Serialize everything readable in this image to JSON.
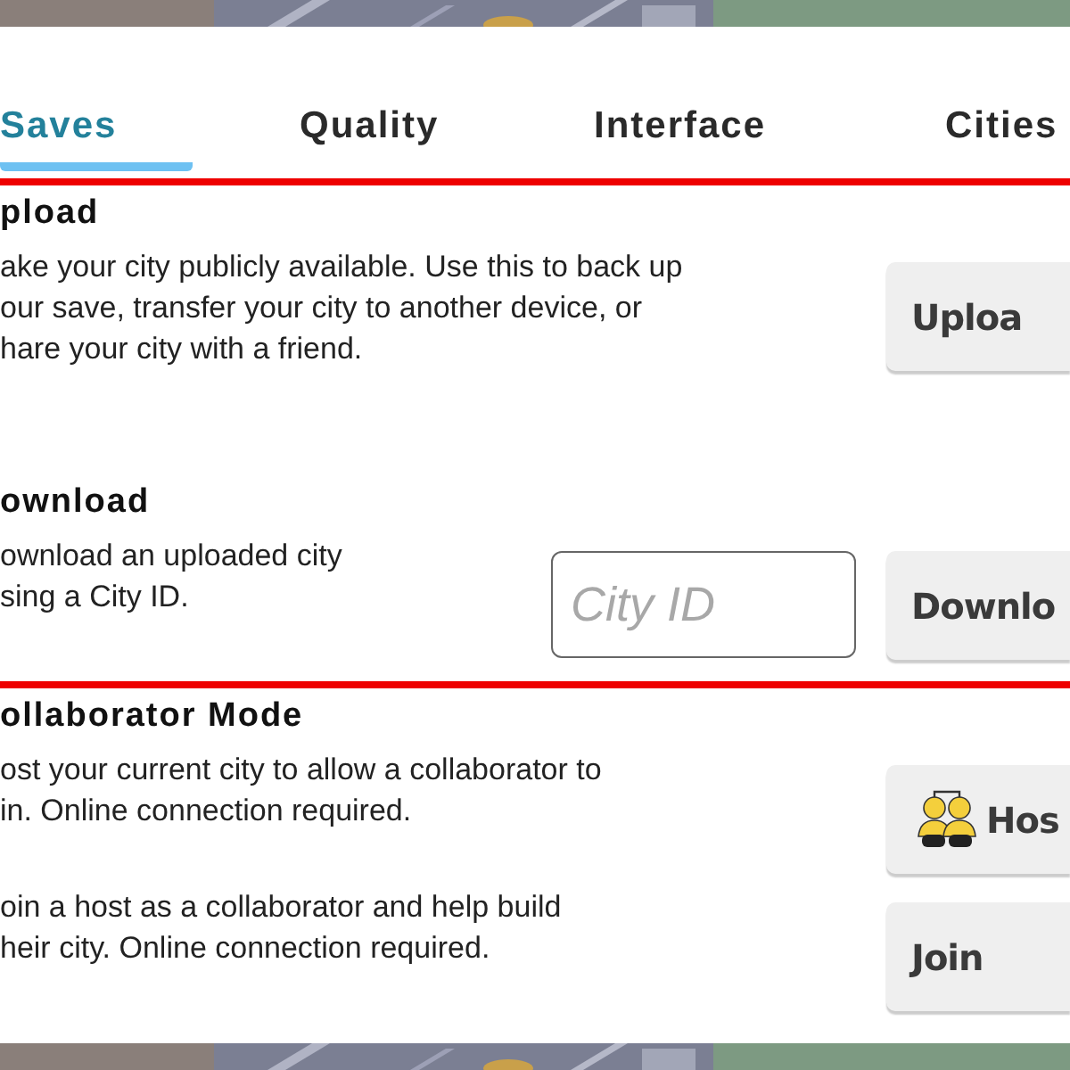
{
  "tabs": [
    {
      "label": "Saves",
      "selected": true
    },
    {
      "label": "Quality",
      "selected": false
    },
    {
      "label": "Interface",
      "selected": false
    },
    {
      "label": "Cities",
      "selected": false
    }
  ],
  "groups": [
    {
      "sections": [
        {
          "title": "pload",
          "items": [
            {
              "description": [
                "ake your city publicly available. Use this to back up",
                "our save, transfer your city to another device, or",
                "hare your city with a friend."
              ],
              "button": {
                "label": "Uploa",
                "kind": "plain"
              }
            }
          ]
        },
        {
          "title": "ownload",
          "items": [
            {
              "description": [
                "ownload an uploaded city",
                "sing a City ID."
              ],
              "field": {
                "placeholder": "City ID"
              },
              "button": {
                "label": "Downlo",
                "kind": "plain"
              }
            }
          ]
        }
      ]
    },
    {
      "sections": [
        {
          "title": "ollaborator Mode",
          "items": [
            {
              "description": [
                "ost your current city to allow a collaborator to",
                "in. Online connection required."
              ],
              "button": {
                "label": "Hos",
                "kind": "with-icon"
              }
            },
            {
              "description": [
                "oin a host as a collaborator and help build",
                "heir city. Online connection required."
              ],
              "button": {
                "label": "Join",
                "kind": "plain"
              }
            }
          ]
        }
      ]
    }
  ]
}
